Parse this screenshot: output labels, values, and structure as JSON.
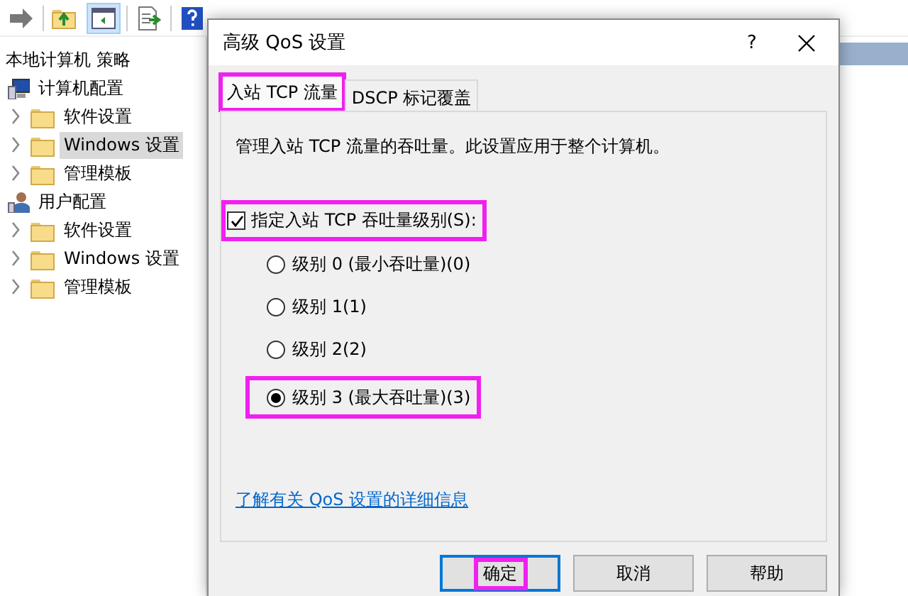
{
  "tree": {
    "title": "本地计算机 策略",
    "items": [
      {
        "label": "计算机配置",
        "kind": "computer",
        "selected": false,
        "children": [
          {
            "label": "软件设置",
            "selected": false,
            "expanded": false
          },
          {
            "label": "Windows 设置",
            "selected": true,
            "expanded": false
          },
          {
            "label": "管理模板",
            "selected": false,
            "expanded": false
          }
        ]
      },
      {
        "label": "用户配置",
        "kind": "user",
        "selected": false,
        "children": [
          {
            "label": "软件设置",
            "selected": false,
            "expanded": false
          },
          {
            "label": "Windows 设置",
            "selected": false,
            "expanded": false
          },
          {
            "label": "管理模板",
            "selected": false,
            "expanded": false
          }
        ]
      }
    ]
  },
  "dialog": {
    "title": "高级 QoS 设置",
    "help_button": "?",
    "tabs": [
      {
        "label": "入站 TCP 流量",
        "selected": true,
        "highlighted": true
      },
      {
        "label": "DSCP 标记覆盖",
        "selected": false,
        "highlighted": false
      }
    ],
    "description": "管理入站 TCP 流量的吞吐量。此设置应用于整个计算机。",
    "checkbox": {
      "label": "指定入站 TCP 吞吐量级别(S):",
      "checked": true,
      "highlighted": true
    },
    "radios": [
      {
        "label": "级别 0 (最小吞吐量)(0)",
        "selected": false,
        "highlighted": false
      },
      {
        "label": "级别 1(1)",
        "selected": false,
        "highlighted": false
      },
      {
        "label": "级别 2(2)",
        "selected": false,
        "highlighted": false
      },
      {
        "label": "级别 3 (最大吞吐量)(3)",
        "selected": true,
        "highlighted": true
      }
    ],
    "link": "了解有关 QoS 设置的详细信息",
    "buttons": [
      {
        "label": "确定",
        "default": true,
        "highlighted": true
      },
      {
        "label": "取消",
        "default": false,
        "highlighted": false
      },
      {
        "label": "帮助",
        "default": false,
        "highlighted": false
      }
    ]
  }
}
